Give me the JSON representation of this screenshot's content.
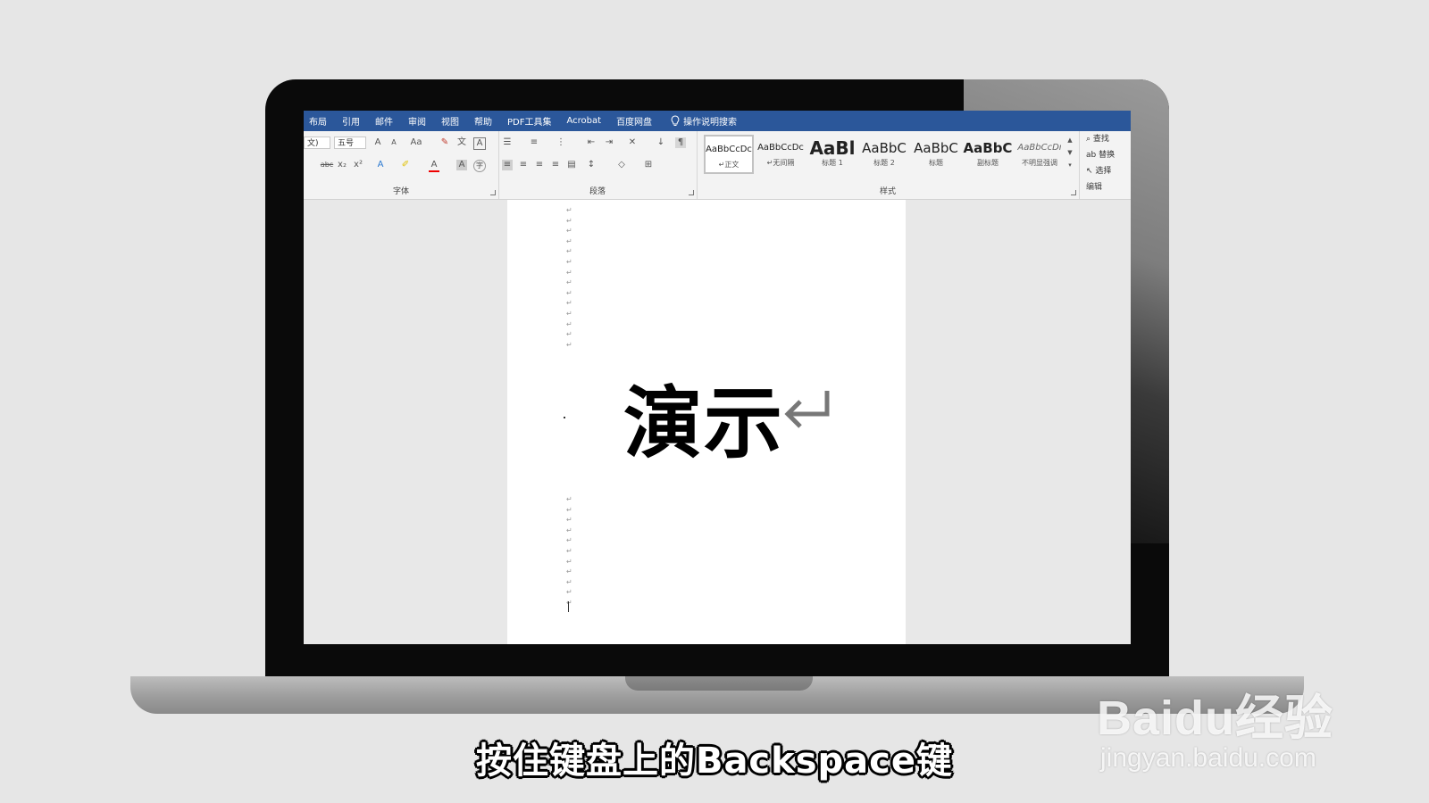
{
  "titlebar": {
    "tabs": [
      "布局",
      "引用",
      "邮件",
      "审阅",
      "视图",
      "帮助",
      "PDF工具集",
      "Acrobat",
      "百度网盘"
    ],
    "search_label": "操作说明搜索"
  },
  "ribbon": {
    "font": {
      "font_name_value": "文)",
      "font_size_value": "五号",
      "group_label": "字体"
    },
    "paragraph": {
      "group_label": "段落"
    },
    "styles": {
      "group_label": "样式",
      "items": [
        {
          "sample": "AaBbCcDc",
          "name": "↵正文"
        },
        {
          "sample": "AaBbCcDc",
          "name": "↵无间隔"
        },
        {
          "sample": "AaBl",
          "name": "标题 1"
        },
        {
          "sample": "AaBbC",
          "name": "标题 2"
        },
        {
          "sample": "AaBbC",
          "name": "标题"
        },
        {
          "sample": "AaBbC",
          "name": "副标题"
        },
        {
          "sample": "AaBbCcDı",
          "name": "不明显强调"
        }
      ]
    },
    "editing": {
      "find_label": "查找",
      "replace_label": "替换",
      "select_label": "选择",
      "group_label": "编辑"
    }
  },
  "document": {
    "main_text": "演示"
  },
  "subtitle": "按住键盘上的Backspace键",
  "watermark": {
    "logo_text": "Baidu经验",
    "url": "jingyan.baidu.com"
  },
  "colors": {
    "titlebar_bg": "#2b579a",
    "ribbon_bg": "#f3f3f3",
    "background": "#e6e6e6"
  }
}
